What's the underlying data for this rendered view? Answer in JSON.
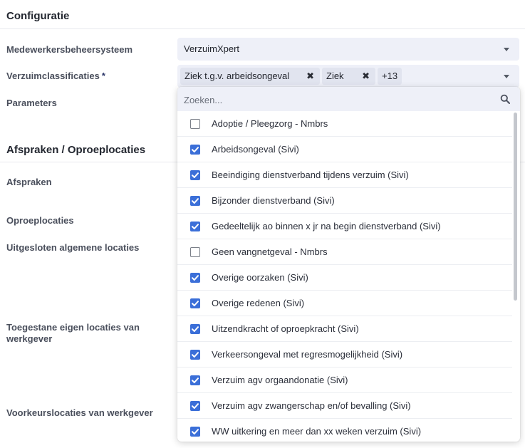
{
  "section1": {
    "title": "Configuratie"
  },
  "fields": {
    "system": {
      "label": "Medewerkersbeheersysteem",
      "value": "VerzuimXpert"
    },
    "classifications": {
      "label": "Verzuimclassificaties",
      "required_mark": "*",
      "chips": [
        "Ziek t.g.v. arbeidsongeval",
        "Ziek"
      ],
      "chip_remove_glyph": "✖",
      "more": "+13"
    },
    "parameters": {
      "label": "Parameters"
    }
  },
  "section2": {
    "title": "Afspraken / Oproeplocaties"
  },
  "labels": {
    "afspraken": "Afspraken",
    "oproeplocaties": "Oproeplocaties",
    "uitgesloten": "Uitgesloten algemene locaties",
    "toegestane_1": "Toegestane eigen locaties van",
    "toegestane_2": "werkgever",
    "voorkeur": "Voorkeurslocaties van werkgever"
  },
  "dropdown": {
    "search_placeholder": "Zoeken...",
    "options": [
      {
        "label": "Adoptie / Pleegzorg - Nmbrs",
        "checked": false
      },
      {
        "label": "Arbeidsongeval (Sivi)",
        "checked": true
      },
      {
        "label": "Beeindiging dienstverband tijdens verzuim (Sivi)",
        "checked": true
      },
      {
        "label": "Bijzonder dienstverband (Sivi)",
        "checked": true
      },
      {
        "label": "Gedeeltelijk ao binnen x jr na begin dienstverband (Sivi)",
        "checked": true
      },
      {
        "label": "Geen vangnetgeval - Nmbrs",
        "checked": false
      },
      {
        "label": "Overige oorzaken (Sivi)",
        "checked": true
      },
      {
        "label": "Overige redenen (Sivi)",
        "checked": true
      },
      {
        "label": "Uitzendkracht of oproepkracht (Sivi)",
        "checked": true
      },
      {
        "label": "Verkeersongeval met regresmogelijkheid (Sivi)",
        "checked": true
      },
      {
        "label": "Verzuim agv orgaandonatie (Sivi)",
        "checked": true
      },
      {
        "label": "Verzuim agv zwangerschap en/of bevalling (Sivi)",
        "checked": true
      },
      {
        "label": "WW uitkering en meer dan xx weken verzuim (Sivi)",
        "checked": true
      }
    ]
  },
  "colors": {
    "accent": "#3b6fd8",
    "field_bg": "#eef0f8",
    "chip_bg": "#e1e4ef"
  }
}
